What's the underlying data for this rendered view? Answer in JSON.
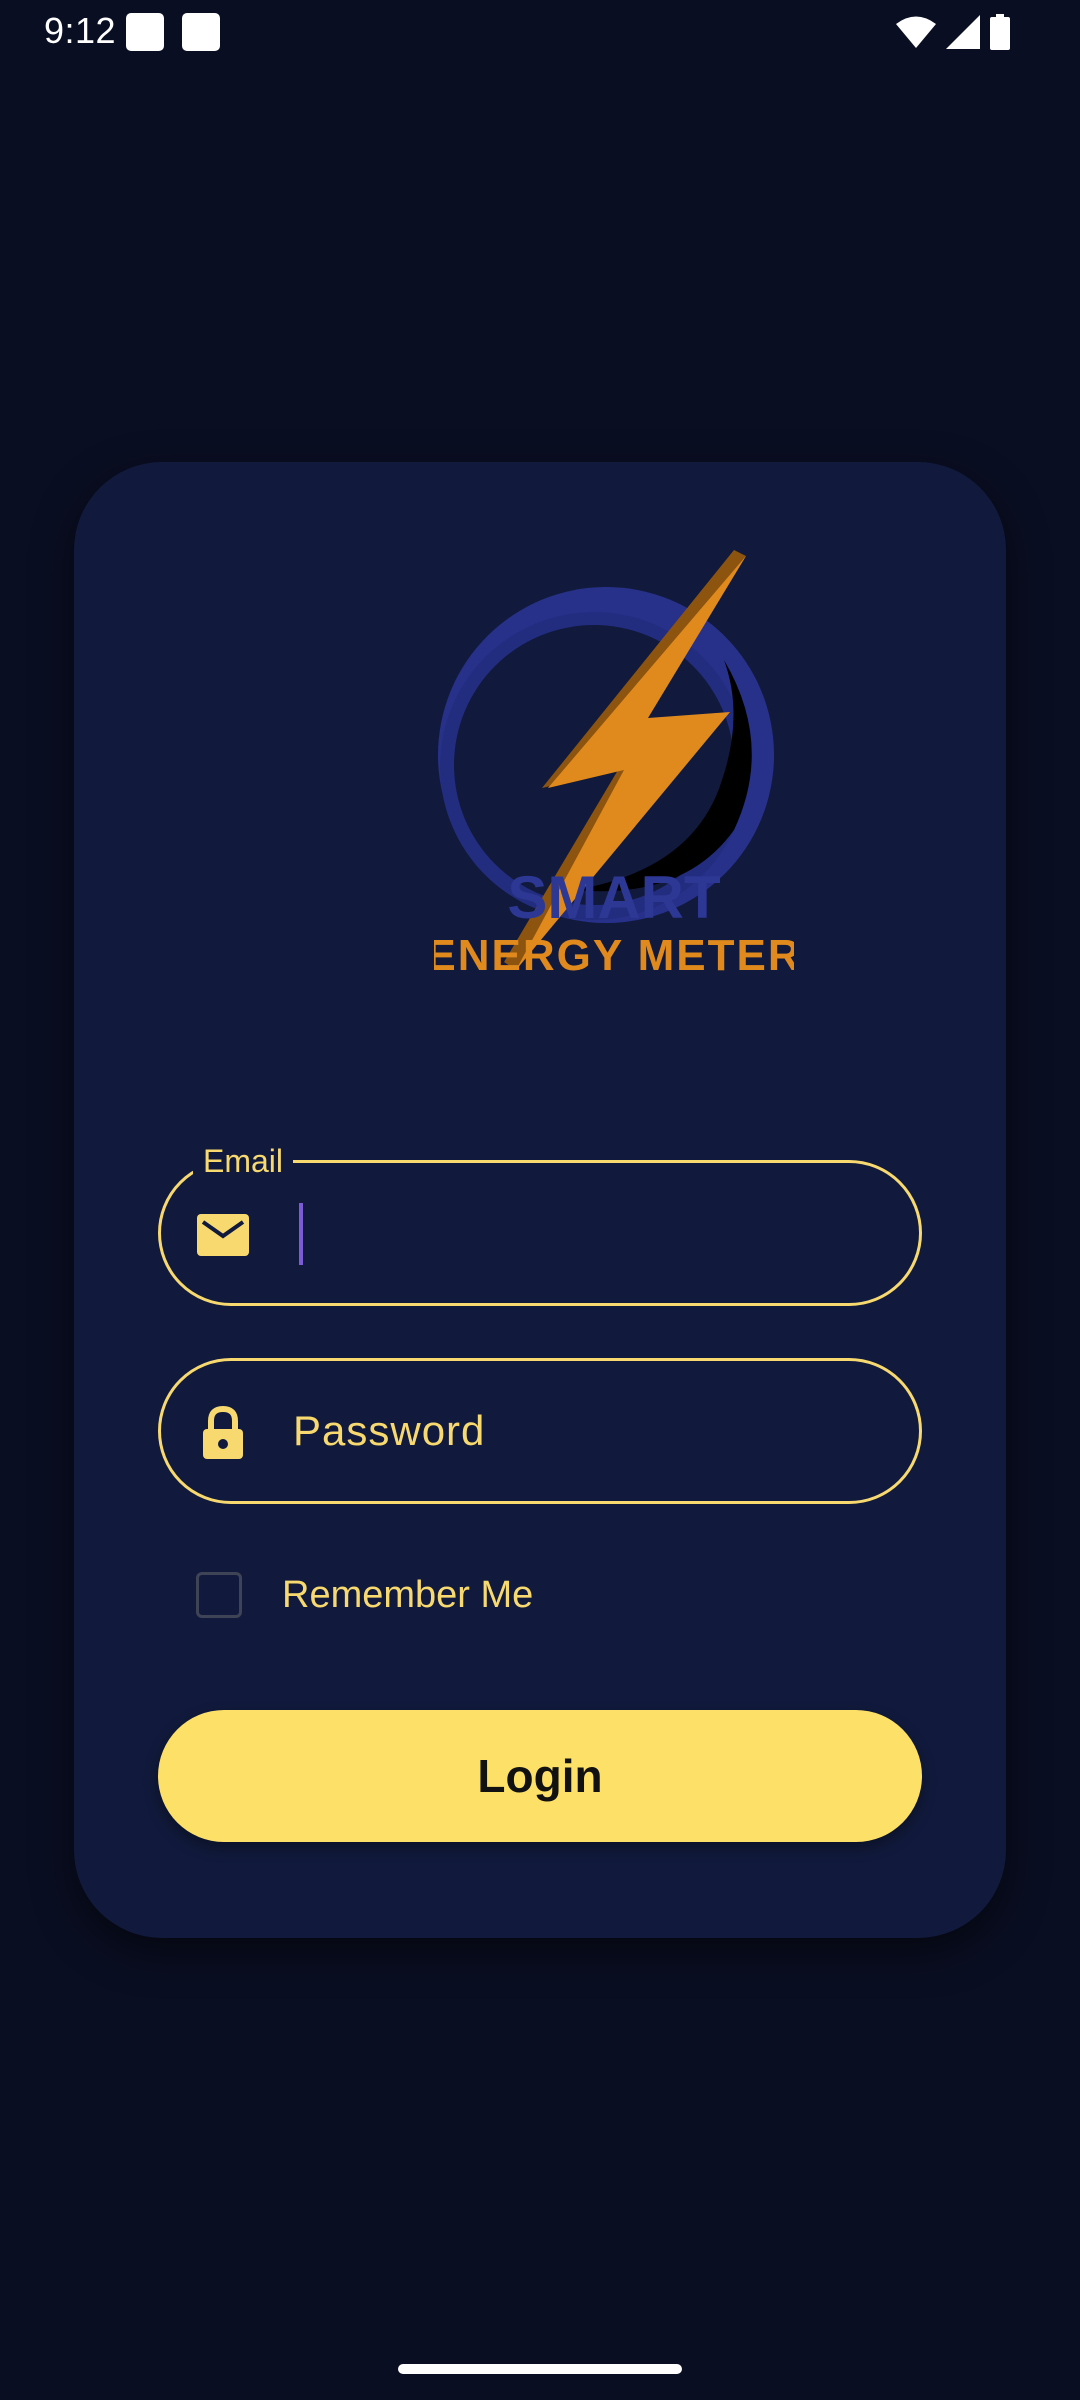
{
  "status_bar": {
    "time": "9:12",
    "icons": [
      "notification-icon",
      "notification-icon",
      "wifi-icon",
      "signal-icon",
      "battery-icon"
    ]
  },
  "logo": {
    "line1": "SMART",
    "line2": "ENERGY METER",
    "colors": {
      "ring": "#2d3794",
      "bolt": "#e08a1e",
      "line1": "#2d3794",
      "line2": "#e08a1e"
    }
  },
  "email_field": {
    "label": "Email",
    "value": "",
    "icon": "envelope-icon"
  },
  "password_field": {
    "placeholder": "Password",
    "icon": "lock-icon"
  },
  "remember": {
    "label": "Remember Me",
    "checked": false
  },
  "login_button": {
    "label": "Login"
  },
  "colors": {
    "background": "#0a0e22",
    "card": "#111a3c",
    "accent": "#f7d970",
    "button": "#fde068"
  }
}
